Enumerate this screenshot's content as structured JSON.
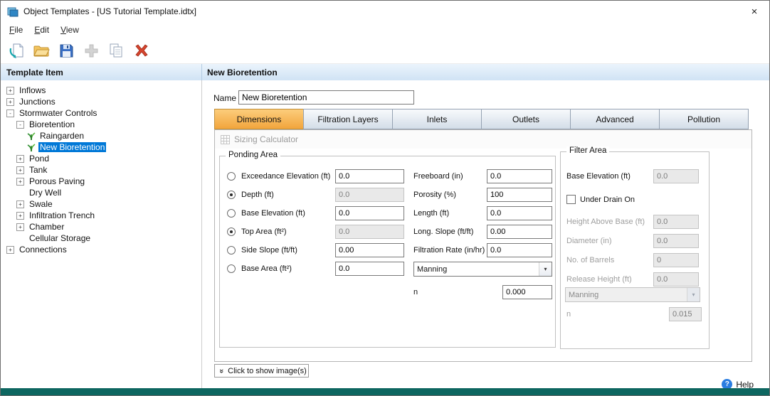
{
  "window": {
    "title": "Object Templates - [US Tutorial Template.idtx]"
  },
  "glyphs": {
    "close": "×",
    "double_chevron_down": "»",
    "help_q": "?",
    "combo_arrow": "▾"
  },
  "menu": {
    "items": [
      {
        "label": "File"
      },
      {
        "label": "Edit"
      },
      {
        "label": "View"
      }
    ]
  },
  "toolbar": {
    "buttons": [
      {
        "name": "new-template",
        "enabled": true
      },
      {
        "name": "open",
        "enabled": true
      },
      {
        "name": "save",
        "enabled": true
      },
      {
        "name": "add",
        "enabled": false
      },
      {
        "name": "copy",
        "enabled": true
      },
      {
        "name": "delete",
        "enabled": true
      }
    ]
  },
  "headers": {
    "left": "Template Item",
    "right": "New Bioretention"
  },
  "tree": {
    "items": [
      {
        "label": "Inflows",
        "level": 0,
        "expander": "+"
      },
      {
        "label": "Junctions",
        "level": 0,
        "expander": "+"
      },
      {
        "label": "Stormwater Controls",
        "level": 0,
        "expander": "-"
      },
      {
        "label": "Bioretention",
        "level": 1,
        "expander": "-"
      },
      {
        "label": "Raingarden",
        "level": 2,
        "icon": "bioretention-leaf",
        "selected": false
      },
      {
        "label": "New Bioretention",
        "level": 2,
        "icon": "bioretention-leaf",
        "selected": true
      },
      {
        "label": "Pond",
        "level": 1,
        "expander": "+"
      },
      {
        "label": "Tank",
        "level": 1,
        "expander": "+"
      },
      {
        "label": "Porous Paving",
        "level": 1,
        "expander": "+"
      },
      {
        "label": "Dry Well",
        "level": 1,
        "expander": ""
      },
      {
        "label": "Swale",
        "level": 1,
        "expander": "+"
      },
      {
        "label": "Infiltration Trench",
        "level": 1,
        "expander": "+"
      },
      {
        "label": "Chamber",
        "level": 1,
        "expander": "+"
      },
      {
        "label": "Cellular Storage",
        "level": 1,
        "expander": ""
      },
      {
        "label": "Connections",
        "level": 0,
        "expander": "+"
      }
    ]
  },
  "form": {
    "name_label": "Name",
    "name_value": "New Bioretention",
    "tabs": [
      {
        "label": "Dimensions",
        "active": true
      },
      {
        "label": "Filtration Layers",
        "active": false
      },
      {
        "label": "Inlets",
        "active": false
      },
      {
        "label": "Outlets",
        "active": false
      },
      {
        "label": "Advanced",
        "active": false
      },
      {
        "label": "Pollution",
        "active": false
      }
    ],
    "sizing_calculator_label": "Sizing Calculator",
    "ponding": {
      "title": "Ponding Area",
      "options": [
        {
          "label": "Exceedance Elevation (ft)",
          "value": "0.0",
          "checked": false,
          "input_disabled": false
        },
        {
          "label": "Depth (ft)",
          "value": "0.0",
          "checked": true,
          "input_disabled": true
        },
        {
          "label": "Base Elevation (ft)",
          "value": "0.0",
          "checked": false,
          "input_disabled": false
        },
        {
          "label": "Top Area (ft²)",
          "value": "0.0",
          "checked": true,
          "input_disabled": true
        },
        {
          "label": "Side Slope (ft/ft)",
          "value": "0.00",
          "checked": false,
          "input_disabled": false
        },
        {
          "label": "Base Area (ft²)",
          "value": "0.0",
          "checked": false,
          "input_disabled": false
        }
      ],
      "fields": [
        {
          "label": "Freeboard (in)",
          "value": "0.0"
        },
        {
          "label": "Porosity (%)",
          "value": "100"
        },
        {
          "label": "Length (ft)",
          "value": "0.0"
        },
        {
          "label": "Long. Slope (ft/ft)",
          "value": "0.00"
        },
        {
          "label": "Filtration Rate (in/hr)",
          "value": "0.0"
        }
      ],
      "roughness_method": "Manning",
      "n_label": "n",
      "n_value": "0.000"
    },
    "filter": {
      "title": "Filter Area",
      "base_elevation": {
        "label": "Base Elevation (ft)",
        "value": "0.0"
      },
      "under_drain_label": "Under Drain On",
      "under_drain_checked": false,
      "fields": [
        {
          "label": "Height Above Base (ft)",
          "value": "0.0"
        },
        {
          "label": "Diameter (in)",
          "value": "0.0"
        },
        {
          "label": "No. of Barrels",
          "value": "0"
        },
        {
          "label": "Release Height (ft)",
          "value": "0.0"
        }
      ],
      "roughness_method": "Manning",
      "n_label": "n",
      "n_value": "0.015"
    },
    "show_images_label": "Click to show image(s)"
  },
  "footer": {
    "help_label": "Help"
  },
  "colors": {
    "selection": "#0078d7",
    "active_tab": "#f2a53c",
    "statusbar": "#0d6660",
    "help_icon": "#2a7de1"
  }
}
